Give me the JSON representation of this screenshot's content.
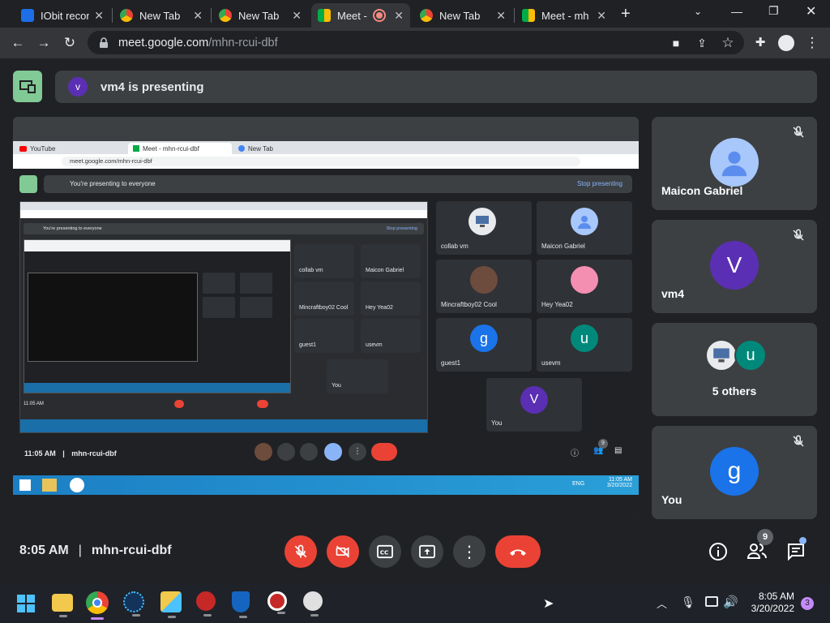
{
  "browser": {
    "tabs": [
      {
        "label": "IObit recon",
        "icon": "iobit-icon",
        "color": "#1e6ee8"
      },
      {
        "label": "New Tab",
        "icon": "chrome-icon",
        "color": "#e8eaed"
      },
      {
        "label": "New Tab",
        "icon": "chrome-icon",
        "color": "#e8eaed"
      },
      {
        "label": "Meet - ",
        "icon": "meet-icon",
        "color": "#00ac47",
        "active": true
      },
      {
        "label": "New Tab",
        "icon": "chrome-icon",
        "color": "#e8eaed"
      },
      {
        "label": "Meet - mh",
        "icon": "meet-icon",
        "color": "#00ac47"
      }
    ],
    "url_host": "meet.google.com",
    "url_path": "/mhn-rcui-dbf"
  },
  "meet": {
    "presenter_initial": "v",
    "presenter_text": "vm4 is presenting",
    "shared": {
      "tabs": [
        "YouTube",
        "Meet - mhn-rcui-dbf",
        "New Tab"
      ],
      "url": "meet.google.com/mhn-rcui-dbf",
      "banner": "You're presenting to everyone",
      "stop": "Stop presenting",
      "inner_banner": "You're presenting to everyone",
      "inner_stop": "Stop presenting",
      "participants": [
        {
          "name": "collab vm",
          "kind": "pc"
        },
        {
          "name": "Maicon Gabriel",
          "kind": "person"
        },
        {
          "name": "Mincraftboy02 Cool",
          "kind": "photo"
        },
        {
          "name": "Hey Yea02",
          "kind": "pink"
        },
        {
          "name": "guest1",
          "initial": "g",
          "color": "#1a73e8"
        },
        {
          "name": "usevm",
          "initial": "u",
          "color": "#00897b"
        },
        {
          "name": "You",
          "initial": "V",
          "color": "#5b2fb3"
        }
      ],
      "time": "11:05 AM",
      "code": "mhn-rcui-dbf",
      "people_badge": "9",
      "task_time": "11:05 AM",
      "task_date": "3/20/2022",
      "task_lang": "ENG"
    },
    "side_tiles": [
      {
        "name": "Maicon Gabriel",
        "kind": "person"
      },
      {
        "name": "vm4",
        "initial": "V",
        "color": "#5b2fb3"
      },
      {
        "name": "5 others",
        "initial": "u",
        "color": "#00897b"
      },
      {
        "name": "You",
        "initial": "g",
        "color": "#1a73e8"
      }
    ],
    "time": "8:05 AM",
    "separator": "|",
    "code": "mhn-rcui-dbf",
    "people_count": "9",
    "colors": {
      "red": "#ea4335",
      "grey": "#3c4043",
      "green": "#81c995"
    }
  },
  "taskbar": {
    "time": "8:05 AM",
    "date": "3/20/2022",
    "notif_count": "3",
    "apps": [
      "windows-start-icon",
      "file-explorer-icon",
      "chrome-icon",
      "app-dots-icon",
      "files-cloud-icon",
      "red-game-icon",
      "shield-icon",
      "camera-app-icon",
      "crossover-icon"
    ]
  }
}
